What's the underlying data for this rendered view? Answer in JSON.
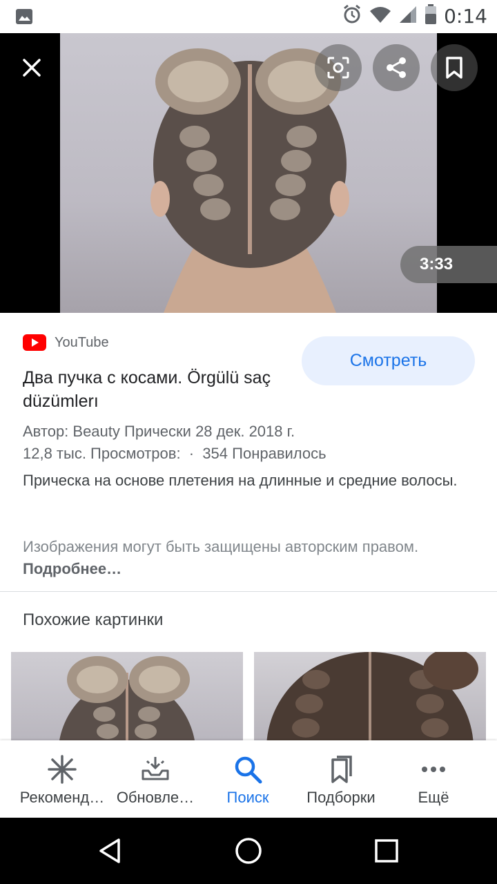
{
  "status_bar": {
    "time": "0:14",
    "icons": [
      "image-notification-icon",
      "alarm-icon",
      "wifi-icon",
      "signal-icon",
      "battery-icon"
    ]
  },
  "media": {
    "duration": "3:33",
    "buttons": [
      "close-icon",
      "lens-icon",
      "share-icon",
      "bookmark-icon"
    ]
  },
  "result": {
    "source": "YouTube",
    "watch_label": "Смотреть",
    "title": "Два пучка с косами. Örgülü saç düzümlerı",
    "meta_line1": "Автор: Beauty Прически 28 дек. 2018 г.",
    "meta_line2": "12,8 тыс. Просмотров:  ·  354 Понравилось",
    "description": "Прическа на основе плетения на длинные и средние волосы.",
    "copyright_text": "Изображения могут быть защищены авторским правом.",
    "copyright_more": "Подробнее…"
  },
  "similar": {
    "title": "Похожие картинки"
  },
  "bottom_nav": {
    "items": [
      {
        "label": "Рекоменд…",
        "icon": "asterisk-icon"
      },
      {
        "label": "Обновле…",
        "icon": "updates-icon"
      },
      {
        "label": "Поиск",
        "icon": "search-icon"
      },
      {
        "label": "Подборки",
        "icon": "collections-icon"
      },
      {
        "label": "Ещё",
        "icon": "more-icon"
      }
    ],
    "active_index": 2
  },
  "colors": {
    "accent": "#1a73e8",
    "youtube_red": "#ff0000",
    "watch_bg": "#e8f0fe"
  }
}
